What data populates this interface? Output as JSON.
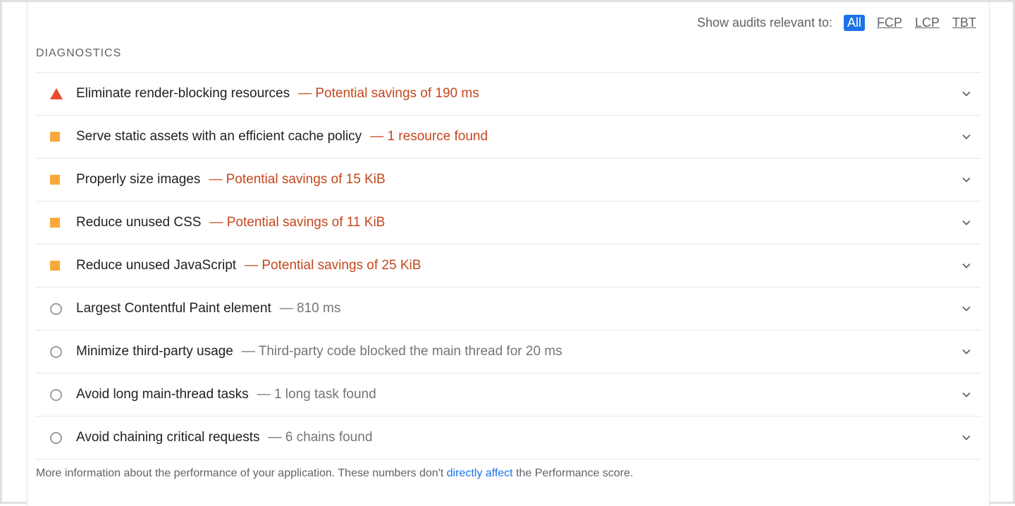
{
  "filter": {
    "label": "Show audits relevant to:",
    "options": [
      "All",
      "FCP",
      "LCP",
      "TBT"
    ],
    "selected": "All"
  },
  "section": {
    "title": "DIAGNOSTICS"
  },
  "audits": [
    {
      "icon": "fail-triangle-icon",
      "title": "Eliminate render-blocking resources",
      "detail": "— Potential savings of 190 ms",
      "severity": "fail"
    },
    {
      "icon": "warn-square-icon",
      "title": "Serve static assets with an efficient cache policy",
      "detail": "— 1 resource found",
      "severity": "warn"
    },
    {
      "icon": "warn-square-icon",
      "title": "Properly size images",
      "detail": "— Potential savings of 15 KiB",
      "severity": "warn"
    },
    {
      "icon": "warn-square-icon",
      "title": "Reduce unused CSS",
      "detail": "— Potential savings of 11 KiB",
      "severity": "warn"
    },
    {
      "icon": "warn-square-icon",
      "title": "Reduce unused JavaScript",
      "detail": "— Potential savings of 25 KiB",
      "severity": "warn"
    },
    {
      "icon": "info-circle-icon",
      "title": "Largest Contentful Paint element",
      "detail": "— 810 ms",
      "severity": "info"
    },
    {
      "icon": "info-circle-icon",
      "title": "Minimize third-party usage",
      "detail": "— Third-party code blocked the main thread for 20 ms",
      "severity": "info"
    },
    {
      "icon": "info-circle-icon",
      "title": "Avoid long main-thread tasks",
      "detail": "— 1 long task found",
      "severity": "info"
    },
    {
      "icon": "info-circle-icon",
      "title": "Avoid chaining critical requests",
      "detail": "— 6 chains found",
      "severity": "info"
    }
  ],
  "footer": {
    "before": "More information about the performance of your application. These numbers don't ",
    "link": "directly affect",
    "after": " the Performance score."
  },
  "colors": {
    "accent": "#1a73e8",
    "fail": "#eb4a33",
    "warn": "#f9a93c",
    "warn_text": "#c5471d",
    "info": "#9e9e9e"
  }
}
